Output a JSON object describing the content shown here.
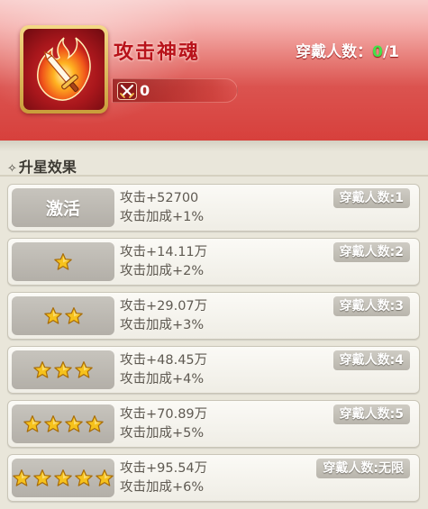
{
  "skill": {
    "title": "攻击神魂",
    "icon": "flaming-sword-icon",
    "count_prefix": "穿戴人数：",
    "count_current": "0",
    "count_total": "/1",
    "power_icon": "crossed-swords-icon",
    "power_value": "0"
  },
  "section": {
    "icon": "diamond-icon",
    "title": "升星效果"
  },
  "rows": [
    {
      "label": "激活",
      "stars": 0,
      "stat1": "攻击+52700",
      "stat2": "攻击加成+1%",
      "wear": "穿戴人数:1"
    },
    {
      "label": "",
      "stars": 1,
      "stat1": "攻击+14.11万",
      "stat2": "攻击加成+2%",
      "wear": "穿戴人数:2"
    },
    {
      "label": "",
      "stars": 2,
      "stat1": "攻击+29.07万",
      "stat2": "攻击加成+3%",
      "wear": "穿戴人数:3"
    },
    {
      "label": "",
      "stars": 3,
      "stat1": "攻击+48.45万",
      "stat2": "攻击加成+4%",
      "wear": "穿戴人数:4"
    },
    {
      "label": "",
      "stars": 4,
      "stat1": "攻击+70.89万",
      "stat2": "攻击加成+5%",
      "wear": "穿戴人数:5"
    },
    {
      "label": "",
      "stars": 5,
      "stat1": "攻击+95.54万",
      "stat2": "攻击加成+6%",
      "wear": "穿戴人数:无限"
    }
  ],
  "colors": {
    "header_red": "#d7403c",
    "title_red": "#b8121a",
    "count_green": "#45e04a",
    "star_gold": "#f6c21c"
  }
}
